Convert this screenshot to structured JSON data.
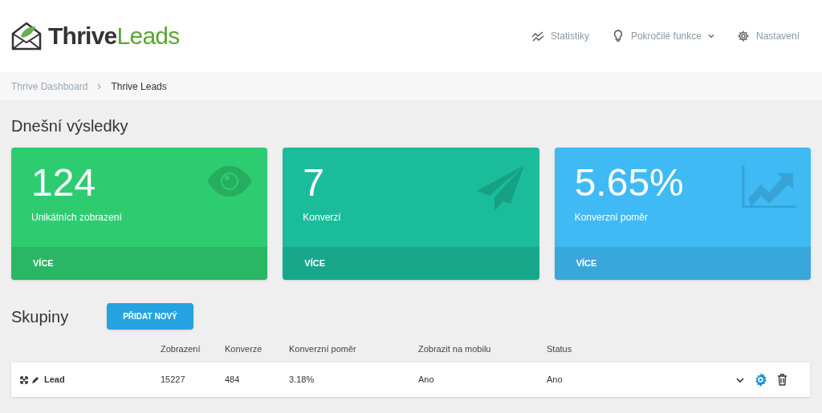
{
  "logo": {
    "dark": "Thrive",
    "light": "Leads"
  },
  "nav": [
    {
      "kind": "stats",
      "label": "Statistiky",
      "dropdown": false
    },
    {
      "kind": "bulb",
      "label": "Pokročilé funkce",
      "dropdown": true
    },
    {
      "kind": "gear",
      "label": "Nastavení",
      "dropdown": false
    }
  ],
  "breadcrumb": [
    {
      "label": "Thrive Dashboard",
      "current": false
    },
    {
      "label": "Thrive Leads",
      "current": true
    }
  ],
  "title": "Dnešní výsledky",
  "cards": [
    {
      "kind": "eye",
      "value": "124",
      "label": "Unikátních zobrazení",
      "link": "VÍCE",
      "color": "#2ecc71"
    },
    {
      "kind": "plane",
      "value": "7",
      "label": "Konverzí",
      "link": "VÍCE",
      "color": "#1abc9c"
    },
    {
      "kind": "chart",
      "value": "5.65%",
      "label": "Konverzní poměr",
      "link": "VÍCE",
      "color": "#3fbaf5"
    }
  ],
  "groups": {
    "title": "Skupiny",
    "add_button": "PŘIDAT NOVÝ",
    "columns": [
      "Zobrazení",
      "Konverze",
      "Konverzní poměr",
      "Zobrazit na mobilu",
      "Status"
    ],
    "rows": [
      {
        "name": "Lead",
        "cells": [
          "15227",
          "484",
          "3.18%",
          "Ano",
          "Ano"
        ]
      }
    ]
  }
}
